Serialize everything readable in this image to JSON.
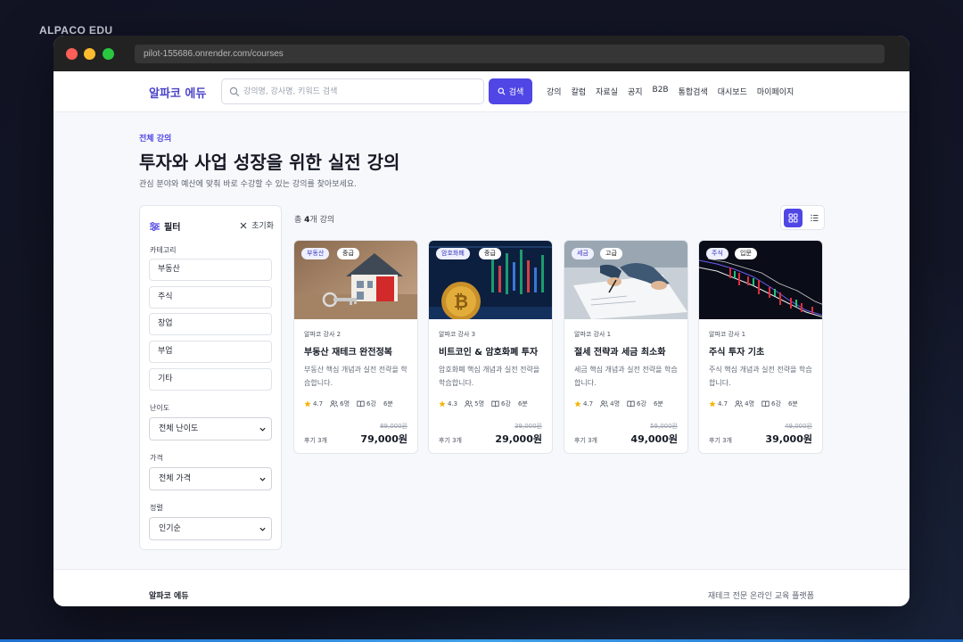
{
  "overlay_label": "ALPACO EDU",
  "browser": {
    "url": "pilot-155686.onrender.com/courses"
  },
  "nav": {
    "brand": "알파코 에듀",
    "search_placeholder": "강의명, 강사명, 키워드 검색",
    "search_button": "검색",
    "links": [
      "강의",
      "칼럼",
      "자료실",
      "공지",
      "B2B",
      "통합검색",
      "대시보드",
      "마이페이지"
    ]
  },
  "header": {
    "eyebrow": "전체 강의",
    "title": "투자와 사업 성장을 위한 실전 강의",
    "subtitle": "관심 분야와 예산에 맞춰 바로 수강할 수 있는 강의를 찾아보세요."
  },
  "filter": {
    "title": "필터",
    "reset": "초기화",
    "category_label": "카테고리",
    "categories": [
      "부동산",
      "주식",
      "창업",
      "부업",
      "기타"
    ],
    "difficulty_label": "난이도",
    "difficulty_value": "전체 난이도",
    "price_label": "가격",
    "price_value": "전체 가격",
    "sort_label": "정렬",
    "sort_value": "인기순"
  },
  "results": {
    "prefix": "총 ",
    "count": "4",
    "suffix": "개 강의"
  },
  "courses": [
    {
      "category": "부동산",
      "level": "중급",
      "instructor": "알파코 강사 2",
      "title": "부동산 재테크 완전정복",
      "desc": "부동산 핵심 개념과 실전 전략을 학습합니다.",
      "rating": "4.7",
      "students": "6명",
      "lessons": "6강",
      "duration": "6분",
      "original_price": "89,000원",
      "reviews": "후기 3개",
      "price": "79,000원"
    },
    {
      "category": "암호화폐",
      "level": "중급",
      "instructor": "알파코 강사 3",
      "title": "비트코인 & 암호화폐 투자",
      "desc": "암호화폐 핵심 개념과 실전 전략을 학습합니다.",
      "rating": "4.3",
      "students": "5명",
      "lessons": "6강",
      "duration": "6분",
      "original_price": "39,000원",
      "reviews": "후기 3개",
      "price": "29,000원"
    },
    {
      "category": "세금",
      "level": "고급",
      "instructor": "알파코 강사 1",
      "title": "절세 전략과 세금 최소화",
      "desc": "세금 핵심 개념과 실전 전략을 학습합니다.",
      "rating": "4.7",
      "students": "4명",
      "lessons": "6강",
      "duration": "6분",
      "original_price": "59,000원",
      "reviews": "후기 3개",
      "price": "49,000원"
    },
    {
      "category": "주식",
      "level": "입문",
      "instructor": "알파코 강사 1",
      "title": "주식 투자 기초",
      "desc": "주식 핵심 개념과 실전 전략을 학습합니다.",
      "rating": "4.7",
      "students": "4명",
      "lessons": "6강",
      "duration": "6분",
      "original_price": "49,000원",
      "reviews": "후기 3개",
      "price": "39,000원"
    }
  ],
  "footer": {
    "brand": "알파코 에듀",
    "tagline": "재테크 전문 온라인 교육 플랫폼"
  },
  "colors": {
    "accent": "#4f46e5",
    "star": "#f5b50a"
  }
}
